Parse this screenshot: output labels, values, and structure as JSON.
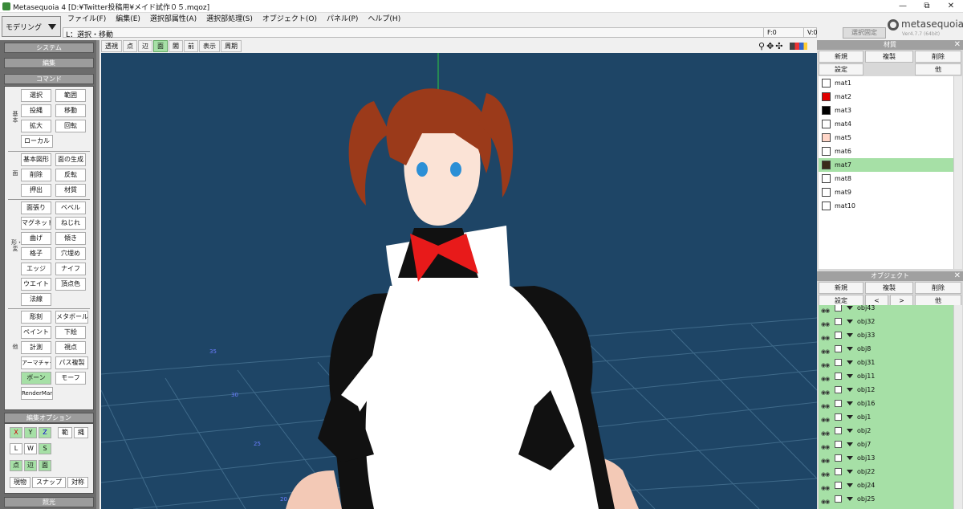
{
  "window": {
    "title": "Metasequoia 4 [D:¥Twitter投稿用¥メイド試作０５.mqoz]",
    "minimize": "—",
    "maximize": "⧉",
    "close": "✕"
  },
  "menu": [
    "ファイル(F)",
    "編集(E)",
    "選択部属性(A)",
    "選択部処理(S)",
    "オブジェクト(O)",
    "パネル(P)",
    "ヘルプ(H)"
  ],
  "mode": {
    "value": "モデリング"
  },
  "status": {
    "hint": "L：選択・移動",
    "f": "F:0",
    "v": "V:0",
    "select_fix": "選択固定"
  },
  "logo": {
    "name": "metasequoia4",
    "version": "Ver4.7.7 (64bit)"
  },
  "view_toolbar": [
    "透視",
    "点",
    "辺",
    "面",
    "閣",
    "前",
    "表示",
    "周期"
  ],
  "left_panel": {
    "system": "システム",
    "edit": "編集",
    "command": "コマンド",
    "groups": [
      {
        "label": "基本",
        "items": [
          "選択",
          "範囲",
          "投縄",
          "移動",
          "拡大",
          "回転",
          "ローカル"
        ]
      },
      {
        "label": "面",
        "items": [
          "基本図形",
          "面の生成",
          "削除",
          "反転",
          "押出",
          "材質"
        ]
      },
      {
        "label": "形・変",
        "items": [
          "面張り",
          "ベベル",
          "マグネット",
          "ねじれ",
          "曲げ",
          "傾き",
          "格子",
          "穴埋め",
          "エッジ",
          "ナイフ",
          "ウエイト",
          "頂点色",
          "法線"
        ]
      },
      {
        "label": "他",
        "items": [
          "彫刻",
          "メタボール",
          "ペイント",
          "下絵",
          "計測",
          "視点",
          "アーマチャー",
          "パス複製",
          "ボーン",
          "モーフ",
          "RenderMan"
        ]
      }
    ],
    "edit_options": {
      "title": "編集オプション",
      "axes": [
        "X",
        "Y",
        "Z"
      ],
      "range": "範",
      "lasso": "縄",
      "lws": [
        "L",
        "W",
        "S"
      ],
      "types": [
        "点",
        "辺",
        "面"
      ],
      "bottom": [
        "現物",
        "スナップ",
        "対称"
      ]
    },
    "lighting": "照光"
  },
  "material_panel": {
    "title": "材質",
    "buttons": [
      "新規",
      "複製",
      "削除"
    ],
    "buttons2": [
      "設定",
      "他"
    ],
    "items": [
      {
        "name": "mat1",
        "color": "#ffffff"
      },
      {
        "name": "mat2",
        "color": "#e00000"
      },
      {
        "name": "mat3",
        "color": "#000000"
      },
      {
        "name": "mat4",
        "color": "#ffffff"
      },
      {
        "name": "mat5",
        "color": "#ffd6c8"
      },
      {
        "name": "mat6",
        "color": "#ffffff"
      },
      {
        "name": "mat7",
        "color": "#3a2a1a"
      },
      {
        "name": "mat8",
        "color": "#ffffff"
      },
      {
        "name": "mat9",
        "color": "#ffffff"
      },
      {
        "name": "mat10",
        "color": "#ffffff"
      }
    ],
    "selected": "mat7"
  },
  "object_panel": {
    "title": "オブジェクト",
    "buttons": [
      "新規",
      "複製",
      "削除"
    ],
    "buttons2": [
      "設定",
      "<",
      ">",
      "他"
    ],
    "items": [
      "obj43",
      "obj32",
      "obj33",
      "obj8",
      "obj31",
      "obj11",
      "obj12",
      "obj16",
      "obj1",
      "obj2",
      "obj7",
      "obj13",
      "obj22",
      "obj24",
      "obj25"
    ]
  },
  "grid_labels": [
    "35",
    "30",
    "25",
    "20"
  ],
  "colors": {
    "viewport": "#1e4566",
    "selected": "#a6e0a6"
  }
}
